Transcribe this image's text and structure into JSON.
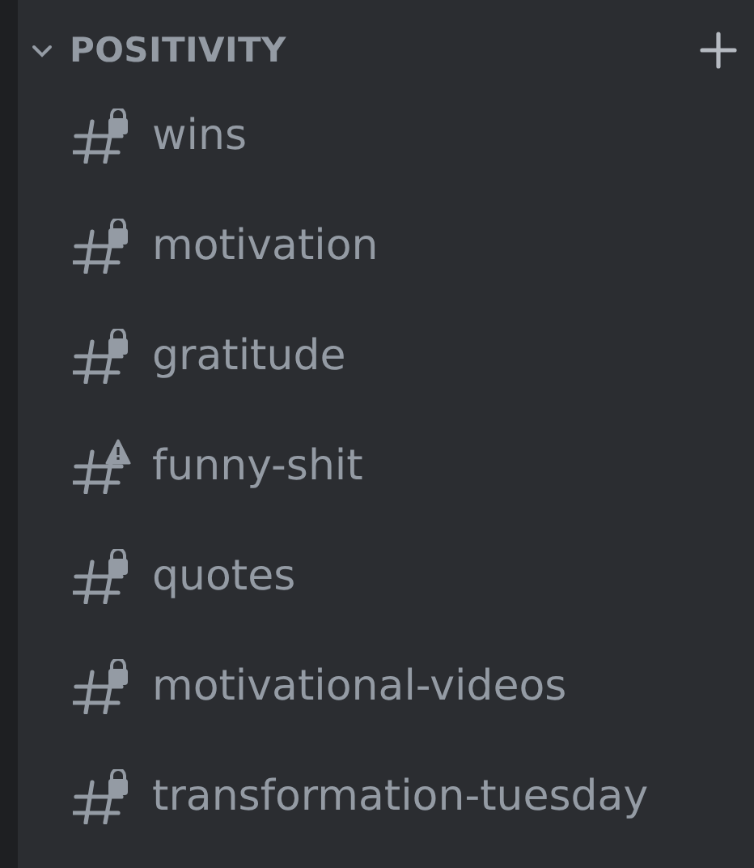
{
  "category": {
    "name": "POSITIVITY",
    "expanded": true
  },
  "channels": [
    {
      "name": "wins",
      "kind": "locked"
    },
    {
      "name": "motivation",
      "kind": "locked"
    },
    {
      "name": "gratitude",
      "kind": "locked"
    },
    {
      "name": "funny-shit",
      "kind": "warning"
    },
    {
      "name": "quotes",
      "kind": "locked"
    },
    {
      "name": "motivational-videos",
      "kind": "locked"
    },
    {
      "name": "transformation-tuesday",
      "kind": "locked"
    }
  ]
}
